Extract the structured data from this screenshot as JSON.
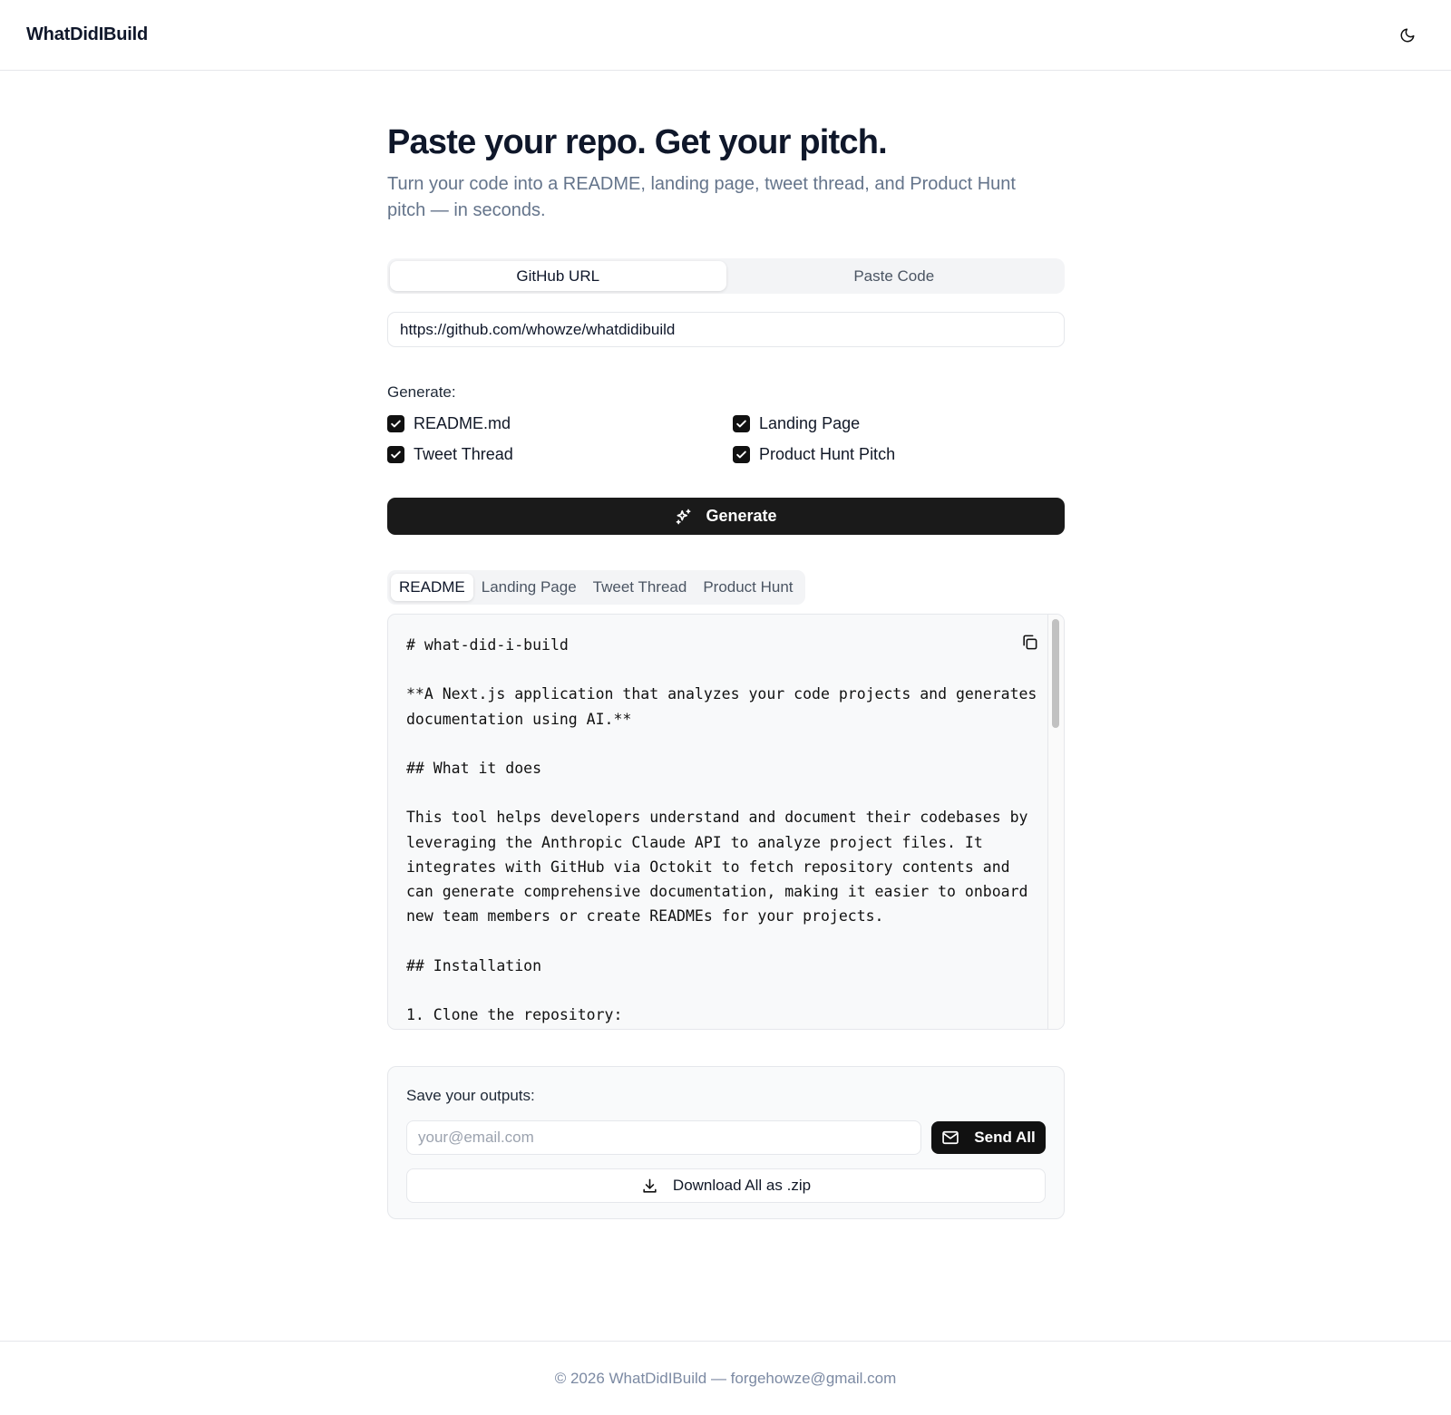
{
  "header": {
    "brand": "WhatDidIBuild",
    "theme_toggle_icon": "moon-icon"
  },
  "hero": {
    "title": "Paste your repo. Get your pitch.",
    "subtitle": "Turn your code into a README, landing page, tweet thread, and Product Hunt pitch — in seconds."
  },
  "input_mode": {
    "tabs": [
      {
        "label": "GitHub URL",
        "active": true
      },
      {
        "label": "Paste Code",
        "active": false
      }
    ],
    "url_value": "https://github.com/whowze/whatdidibuild"
  },
  "generate_options": {
    "label": "Generate:",
    "items": [
      {
        "label": "README.md",
        "checked": true
      },
      {
        "label": "Landing Page",
        "checked": true
      },
      {
        "label": "Tweet Thread",
        "checked": true
      },
      {
        "label": "Product Hunt Pitch",
        "checked": true
      }
    ],
    "button_label": "Generate",
    "button_icon": "sparkles-icon"
  },
  "output": {
    "tabs": [
      {
        "label": "README",
        "active": true
      },
      {
        "label": "Landing Page",
        "active": false
      },
      {
        "label": "Tweet Thread",
        "active": false
      },
      {
        "label": "Product Hunt",
        "active": false
      }
    ],
    "content": "# what-did-i-build\n\n**A Next.js application that analyzes your code projects and generates documentation using AI.**\n\n## What it does\n\nThis tool helps developers understand and document their codebases by leveraging the Anthropic Claude API to analyze project files. It integrates with GitHub via Octokit to fetch repository contents and can generate comprehensive documentation, making it easier to onboard new team members or create READMEs for your projects.\n\n## Installation\n\n1. Clone the repository:",
    "copy_icon": "copy-icon"
  },
  "save": {
    "label": "Save your outputs:",
    "email_placeholder": "your@email.com",
    "send_label": "Send All",
    "download_label": "Download All as .zip"
  },
  "footer": {
    "text": "© 2026 WhatDidIBuild — forgehowze@gmail.com"
  }
}
